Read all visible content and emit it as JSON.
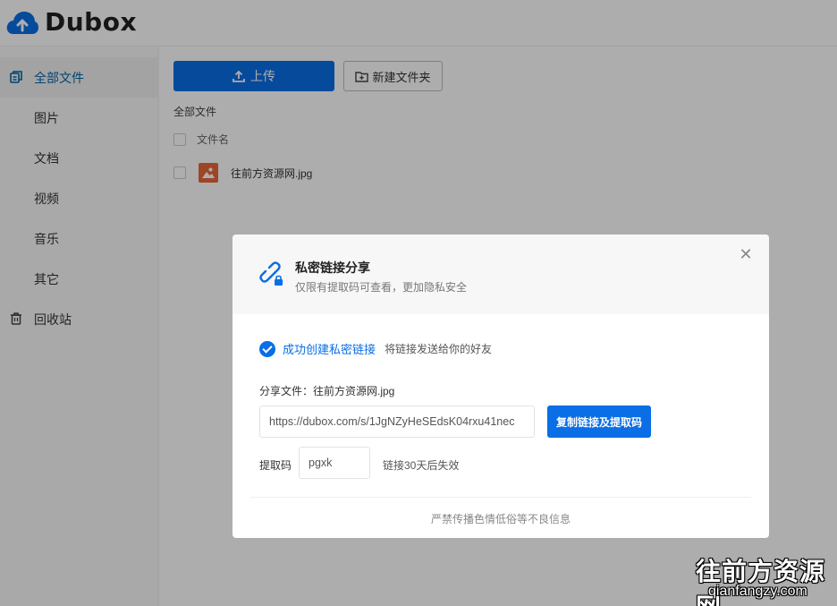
{
  "app": {
    "logo_text": "Dubox",
    "brand_color": "#0a6ee6"
  },
  "sidebar": {
    "items": [
      {
        "label": "全部文件",
        "icon": "files-icon",
        "active": true
      },
      {
        "label": "图片"
      },
      {
        "label": "文档"
      },
      {
        "label": "视频"
      },
      {
        "label": "音乐"
      },
      {
        "label": "其它"
      },
      {
        "label": "回收站",
        "icon": "trash-icon"
      }
    ]
  },
  "toolbar": {
    "upload_label": "上传",
    "new_folder_label": "新建文件夹"
  },
  "main": {
    "breadcrumb": "全部文件",
    "column_filename": "文件名",
    "files": [
      {
        "name": "往前方资源网.jpg",
        "icon": "image-file-icon"
      }
    ]
  },
  "dialog": {
    "title": "私密链接分享",
    "subtitle": "仅限有提取码可查看，更加隐私安全",
    "success_text": "成功创建私密链接",
    "success_hint": "将链接发送给你的好友",
    "share_file": "分享文件：往前方资源网.jpg",
    "link_value": "https://dubox.com/s/1JgNZyHeSEdsK04rxu41nec",
    "copy_button": "复制链接及提取码",
    "code_label": "提取码",
    "code_value": "pgxk",
    "expire_text": "链接30天后失效",
    "footer_note": "严禁传播色情低俗等不良信息",
    "close_icon": "close-icon"
  },
  "watermark": {
    "title": "往前方资源网",
    "url": "qianfangzy.com"
  }
}
